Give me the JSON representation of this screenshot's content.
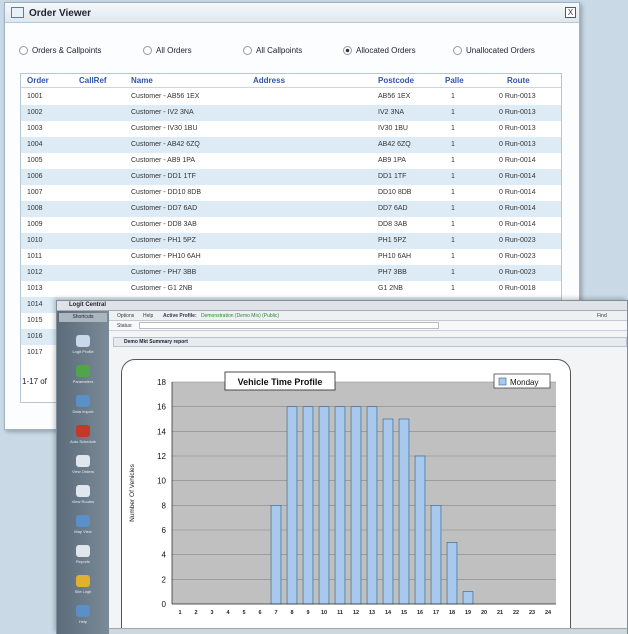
{
  "order_viewer": {
    "title": "Order Viewer",
    "close_label": "X",
    "filters": [
      {
        "label": "Orders & Callpoints",
        "selected": false
      },
      {
        "label": "All Orders",
        "selected": false
      },
      {
        "label": "All Callpoints",
        "selected": false
      },
      {
        "label": "Allocated Orders",
        "selected": true
      },
      {
        "label": "Unallocated Orders",
        "selected": false
      }
    ],
    "columns": [
      "Order",
      "CallRef",
      "Name",
      "Address",
      "Postcode",
      "Palle",
      "Route"
    ],
    "rows": [
      [
        "1001",
        "",
        "Customer - AB56 1EX",
        "",
        "AB56 1EX",
        "1",
        "0 Run-0013"
      ],
      [
        "1002",
        "",
        "Customer - IV2 3NA",
        "",
        "IV2 3NA",
        "1",
        "0 Run-0013"
      ],
      [
        "1003",
        "",
        "Customer - IV30 1BU",
        "",
        "IV30 1BU",
        "1",
        "0 Run-0013"
      ],
      [
        "1004",
        "",
        "Customer - AB42 6ZQ",
        "",
        "AB42 6ZQ",
        "1",
        "0 Run-0013"
      ],
      [
        "1005",
        "",
        "Customer - AB9 1PA",
        "",
        "AB9 1PA",
        "1",
        "0 Run-0014"
      ],
      [
        "1006",
        "",
        "Customer - DD1 1TF",
        "",
        "DD1 1TF",
        "1",
        "0 Run-0014"
      ],
      [
        "1007",
        "",
        "Customer - DD10 8DB",
        "",
        "DD10 8DB",
        "1",
        "0 Run-0014"
      ],
      [
        "1008",
        "",
        "Customer - DD7 6AD",
        "",
        "DD7 6AD",
        "1",
        "0 Run-0014"
      ],
      [
        "1009",
        "",
        "Customer - DD8 3AB",
        "",
        "DD8 3AB",
        "1",
        "0 Run-0014"
      ],
      [
        "1010",
        "",
        "Customer - PH1 5PZ",
        "",
        "PH1 5PZ",
        "1",
        "0 Run-0023"
      ],
      [
        "1011",
        "",
        "Customer - PH10 6AH",
        "",
        "PH10 6AH",
        "1",
        "0 Run-0023"
      ],
      [
        "1012",
        "",
        "Customer - PH7 3BB",
        "",
        "PH7 3BB",
        "1",
        "0 Run-0023"
      ],
      [
        "1013",
        "",
        "Customer - G1 2NB",
        "",
        "G1 2NB",
        "1",
        "0 Run-0018"
      ],
      [
        "1014",
        "",
        "",
        "",
        "",
        "",
        ""
      ],
      [
        "1015",
        "",
        "",
        "",
        "",
        "",
        ""
      ],
      [
        "1016",
        "",
        "",
        "",
        "",
        "",
        ""
      ],
      [
        "1017",
        "",
        "",
        "",
        "",
        "",
        ""
      ]
    ],
    "pager": "1-17 of"
  },
  "logit": {
    "title": "Logit Central",
    "shortcuts_label": "Shortcuts",
    "nav_items": [
      "Logit Profile",
      "Parameters",
      "Data Import",
      "Auto Schedule",
      "View Orders",
      "View Routes",
      "Map View",
      "Reports",
      "Site Logit",
      "Help"
    ],
    "toolbar_items": [
      "Options",
      "Help",
      "Active Profile:",
      "Demonstration (Demo Mix) (Public)"
    ],
    "toolbar_right": "Find",
    "status_label": "Status:",
    "report_title": "Demo Mkt Summary report"
  },
  "chart_data": {
    "type": "bar",
    "title": "Vehicle Time Profile",
    "ylabel": "Number Of Vehicles",
    "xlabel": "",
    "ylim": [
      0,
      18
    ],
    "yticks": [
      0,
      2,
      4,
      6,
      8,
      10,
      12,
      14,
      16,
      18
    ],
    "categories": [
      "1",
      "2",
      "3",
      "4",
      "5",
      "6",
      "7",
      "8",
      "9",
      "10",
      "11",
      "12",
      "13",
      "14",
      "15",
      "16",
      "17",
      "18",
      "19",
      "20",
      "21",
      "22",
      "23",
      "24"
    ],
    "series": [
      {
        "name": "Monday",
        "values": [
          0,
          0,
          0,
          0,
          0,
          0,
          8,
          16,
          16,
          16,
          16,
          16,
          16,
          15,
          15,
          12,
          8,
          5,
          1,
          0,
          0,
          0,
          0,
          0
        ]
      }
    ],
    "grid": true,
    "legend": "top-right",
    "colors": {
      "bar": "#a6c9ec",
      "bar_edge": "#2f5f8f",
      "plot_bg": "#c0c0c0"
    }
  }
}
